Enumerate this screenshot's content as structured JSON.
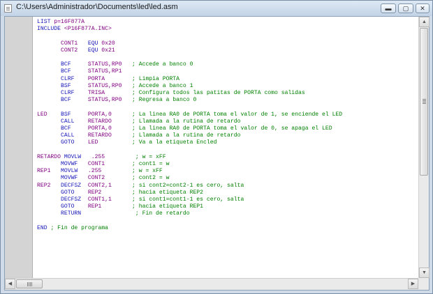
{
  "window": {
    "title": "C:\\Users\\Administrador\\Documents\\led\\led.asm",
    "min_glyph": "▬",
    "max_glyph": "▢",
    "close_glyph": "✕"
  },
  "scrollbar": {
    "up": "▲",
    "down": "▼",
    "left": "◀",
    "right": "▶"
  },
  "colors": {
    "keyword": "#1515b8",
    "string": "#800080",
    "comment": "#008000"
  },
  "code_lines": [
    [
      {
        "t": "LIST ",
        "c": "k"
      },
      {
        "t": "p=16F877A",
        "c": "s"
      }
    ],
    [
      {
        "t": "INCLUDE ",
        "c": "k"
      },
      {
        "t": "<P16F877A.INC>",
        "c": "s"
      }
    ],
    [],
    [
      {
        "t": "       CONT1   ",
        "c": "s"
      },
      {
        "t": "EQU",
        "c": "k"
      },
      {
        "t": " 0x20",
        "c": "s"
      }
    ],
    [
      {
        "t": "       CONT2   ",
        "c": "s"
      },
      {
        "t": "EQU",
        "c": "k"
      },
      {
        "t": " 0x21",
        "c": "s"
      }
    ],
    [],
    [
      {
        "t": "       BCF     ",
        "c": "k"
      },
      {
        "t": "STATUS,RP0   ",
        "c": "s"
      },
      {
        "t": "; Accede a banco 0",
        "c": "c"
      }
    ],
    [
      {
        "t": "       BCF     ",
        "c": "k"
      },
      {
        "t": "STATUS,RP1",
        "c": "s"
      }
    ],
    [
      {
        "t": "       CLRF    ",
        "c": "k"
      },
      {
        "t": "PORTA        ",
        "c": "s"
      },
      {
        "t": "; Limpia PORTA",
        "c": "c"
      }
    ],
    [
      {
        "t": "       BSF     ",
        "c": "k"
      },
      {
        "t": "STATUS,RP0   ",
        "c": "s"
      },
      {
        "t": "; Accede a banco 1",
        "c": "c"
      }
    ],
    [
      {
        "t": "       CLRF    ",
        "c": "k"
      },
      {
        "t": "TRISA        ",
        "c": "s"
      },
      {
        "t": "; Configura todos las patitas de PORTA como salidas",
        "c": "c"
      }
    ],
    [
      {
        "t": "       BCF     ",
        "c": "k"
      },
      {
        "t": "STATUS,RP0   ",
        "c": "s"
      },
      {
        "t": "; Regresa a banco 0",
        "c": "c"
      }
    ],
    [],
    [
      {
        "t": "LED    ",
        "c": "s"
      },
      {
        "t": "BSF     ",
        "c": "k"
      },
      {
        "t": "PORTA,0      ",
        "c": "s"
      },
      {
        "t": "; La linea RA0 de PORTA toma el valor de 1, se enciende el LED",
        "c": "c"
      }
    ],
    [
      {
        "t": "       CALL    ",
        "c": "k"
      },
      {
        "t": "RETARDO      ",
        "c": "s"
      },
      {
        "t": "; Llamada a la rutina de retardo",
        "c": "c"
      }
    ],
    [
      {
        "t": "       BCF     ",
        "c": "k"
      },
      {
        "t": "PORTA,0      ",
        "c": "s"
      },
      {
        "t": "; La linea RA0 de PORTA toma el valor de 0, se apaga el LED",
        "c": "c"
      }
    ],
    [
      {
        "t": "       CALL    ",
        "c": "k"
      },
      {
        "t": "RETARDO      ",
        "c": "s"
      },
      {
        "t": "; Llamada a la rutina de retardo",
        "c": "c"
      }
    ],
    [
      {
        "t": "       GOTO    ",
        "c": "k"
      },
      {
        "t": "LED          ",
        "c": "s"
      },
      {
        "t": "; Va a la etiqueta Encled",
        "c": "c"
      }
    ],
    [],
    [
      {
        "t": "RETARDO ",
        "c": "s"
      },
      {
        "t": "MOVLW   ",
        "c": "k"
      },
      {
        "t": ".255         ",
        "c": "s"
      },
      {
        "t": "; w = xFF",
        "c": "c"
      }
    ],
    [
      {
        "t": "       MOVWF   ",
        "c": "k"
      },
      {
        "t": "CONT1        ",
        "c": "s"
      },
      {
        "t": "; cont1 = w",
        "c": "c"
      }
    ],
    [
      {
        "t": "REP1   ",
        "c": "s"
      },
      {
        "t": "MOVLW   ",
        "c": "k"
      },
      {
        "t": ".255         ",
        "c": "s"
      },
      {
        "t": "; w = xFF",
        "c": "c"
      }
    ],
    [
      {
        "t": "       MOVWF   ",
        "c": "k"
      },
      {
        "t": "CONT2        ",
        "c": "s"
      },
      {
        "t": "; cont2 = w",
        "c": "c"
      }
    ],
    [
      {
        "t": "REP2   ",
        "c": "s"
      },
      {
        "t": "DECFSZ  ",
        "c": "k"
      },
      {
        "t": "CONT2,1      ",
        "c": "s"
      },
      {
        "t": "; si cont2=cont2-1 es cero, salta",
        "c": "c"
      }
    ],
    [
      {
        "t": "       GOTO    ",
        "c": "k"
      },
      {
        "t": "REP2         ",
        "c": "s"
      },
      {
        "t": "; hacia etiqueta REP2",
        "c": "c"
      }
    ],
    [
      {
        "t": "       DECFSZ  ",
        "c": "k"
      },
      {
        "t": "CONT1,1      ",
        "c": "s"
      },
      {
        "t": "; si cont1=cont1-1 es cero, salta",
        "c": "c"
      }
    ],
    [
      {
        "t": "       GOTO    ",
        "c": "k"
      },
      {
        "t": "REP1         ",
        "c": "s"
      },
      {
        "t": "; hacia etiqueta REP1",
        "c": "c"
      }
    ],
    [
      {
        "t": "       RETURN       ",
        "c": "k"
      },
      {
        "t": "         ",
        "c": "s"
      },
      {
        "t": "; Fin de retardo",
        "c": "c"
      }
    ],
    [],
    [
      {
        "t": "END ",
        "c": "k"
      },
      {
        "t": "; Fin de programa",
        "c": "c"
      }
    ]
  ]
}
